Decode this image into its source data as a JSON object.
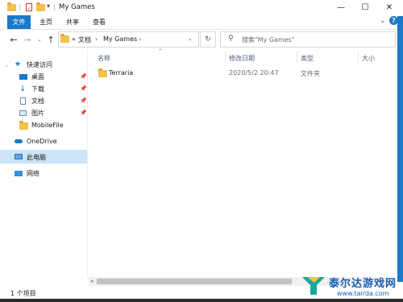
{
  "window": {
    "title": "My Games"
  },
  "ribbon": {
    "tabs": [
      "文件",
      "主页",
      "共享",
      "查看"
    ]
  },
  "address": {
    "prefix": "«",
    "segments": [
      "文档",
      "My Games"
    ]
  },
  "search": {
    "placeholder": "搜索\"My Games\""
  },
  "sidebar": {
    "quick_access": "快速访问",
    "pinned": [
      {
        "label": "桌面",
        "icon": "desktop-icon"
      },
      {
        "label": "下载",
        "icon": "download-icon"
      },
      {
        "label": "文档",
        "icon": "document-icon"
      },
      {
        "label": "图片",
        "icon": "picture-icon"
      }
    ],
    "other": "MobileFile",
    "onedrive": "OneDrive",
    "this_pc": "此电脑",
    "network": "网络"
  },
  "columns": {
    "name": "名称",
    "modified": "修改日期",
    "type": "类型",
    "size": "大小"
  },
  "files": [
    {
      "name": "Terraria",
      "modified": "2020/5/2 20:47",
      "type": "文件夹"
    }
  ],
  "status": {
    "count": "1 个项目"
  },
  "watermark": {
    "brand": "泰尔达游戏网",
    "url": "www.tairda.com"
  },
  "colors": {
    "accent": "#1979ca",
    "selection": "#cce4f7",
    "folder": "#f2c14e"
  }
}
